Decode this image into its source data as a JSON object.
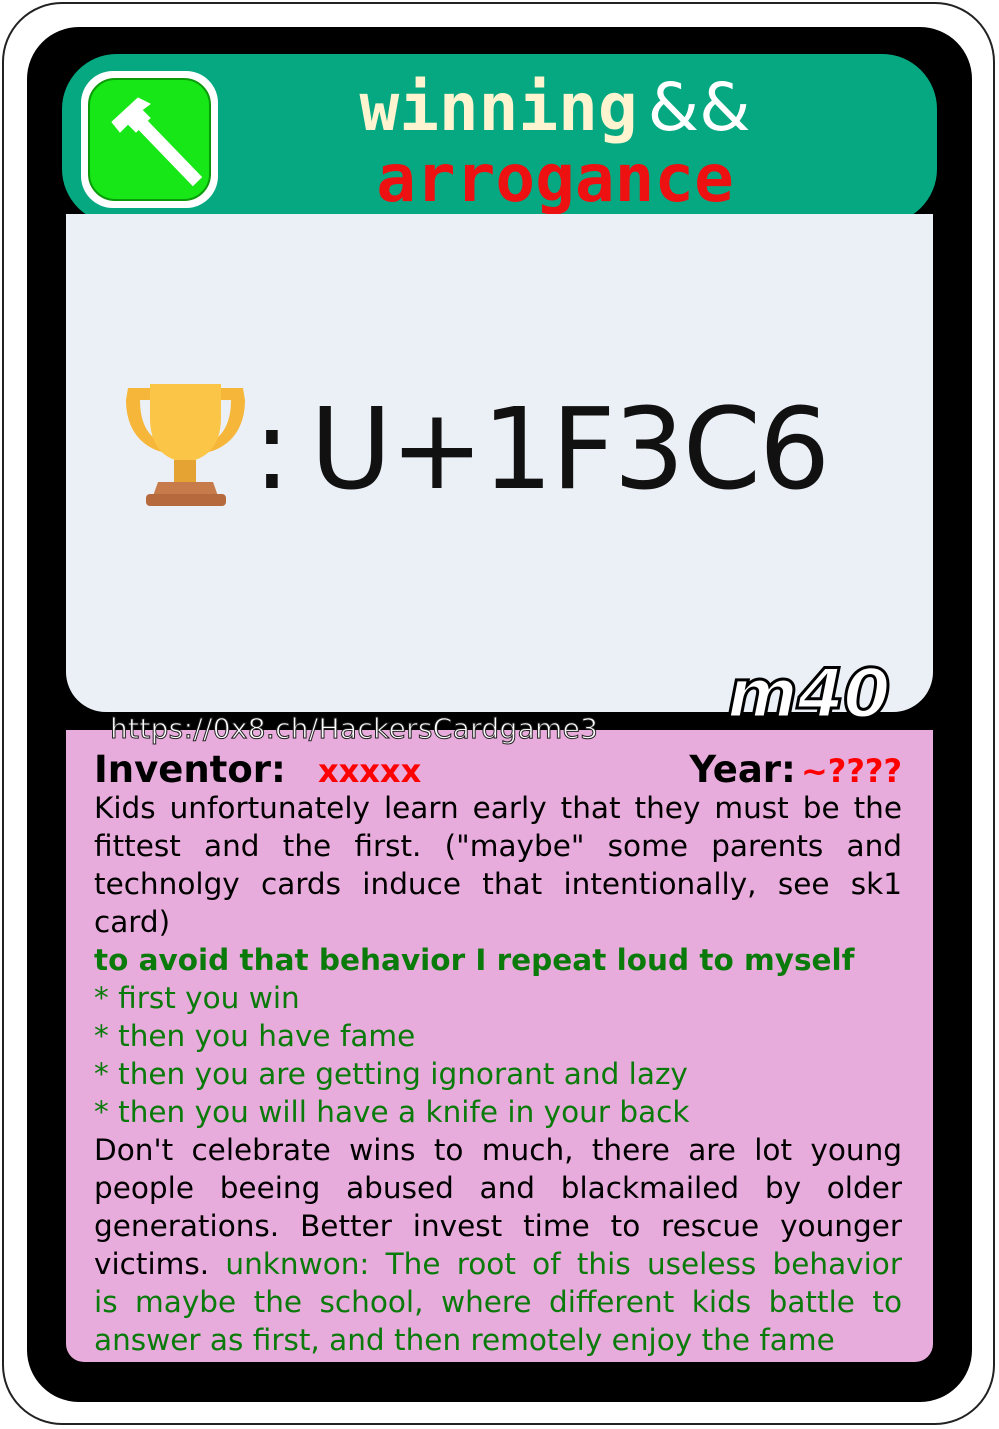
{
  "card": {
    "title_line1": "winning",
    "title_amp": "&&",
    "title_line2": "arrogance",
    "icon": "hammer-icon",
    "image_symbol": "trophy-icon",
    "image_colon": ":",
    "image_text": "U+1F3C6",
    "code": "m40",
    "url": "https://0x8.ch/HackersCardgame3"
  },
  "meta": {
    "inventor_label": "Inventor:",
    "inventor_value": "xxxxx",
    "year_label": "Year:",
    "year_value": "~????"
  },
  "body": {
    "p1_line1": "Kids unfortunately learn early that they must be the",
    "p1_line2": "fittest and the first. (\"maybe\" some parents and",
    "p1_line3": "technolgy cards induce that intentionally, see sk1",
    "p1_line4": "card)",
    "green_heading": "to avoid that behavior I repeat loud to myself",
    "list": [
      "* first you win",
      "* then you have fame",
      "* then you are getting ignorant and lazy",
      "* then you will have a knife in your back"
    ],
    "p2_line1": "Don't celebrate wins to much, there are lot young",
    "p2_line2": "people beeing abused and blackmailed by older",
    "p2_line3": "generations. Better invest time to rescue younger",
    "p2_line4_black": "victims.",
    "p2_line4_green": "unknwon: The root of this useless behavior",
    "p2_line5": "is maybe the school, where different kids battle to",
    "p2_line6": "answer as first, and then remotely enjoy the fame"
  },
  "colors": {
    "header": "#06a882",
    "icon_bg": "#17e617",
    "title_line1": "#fff4d0",
    "title_line2": "#ee1111",
    "image_bg": "#ebf0f7",
    "content_bg": "#e8acdc",
    "accent_red": "#ff0000",
    "accent_green": "#0a7a0a"
  }
}
